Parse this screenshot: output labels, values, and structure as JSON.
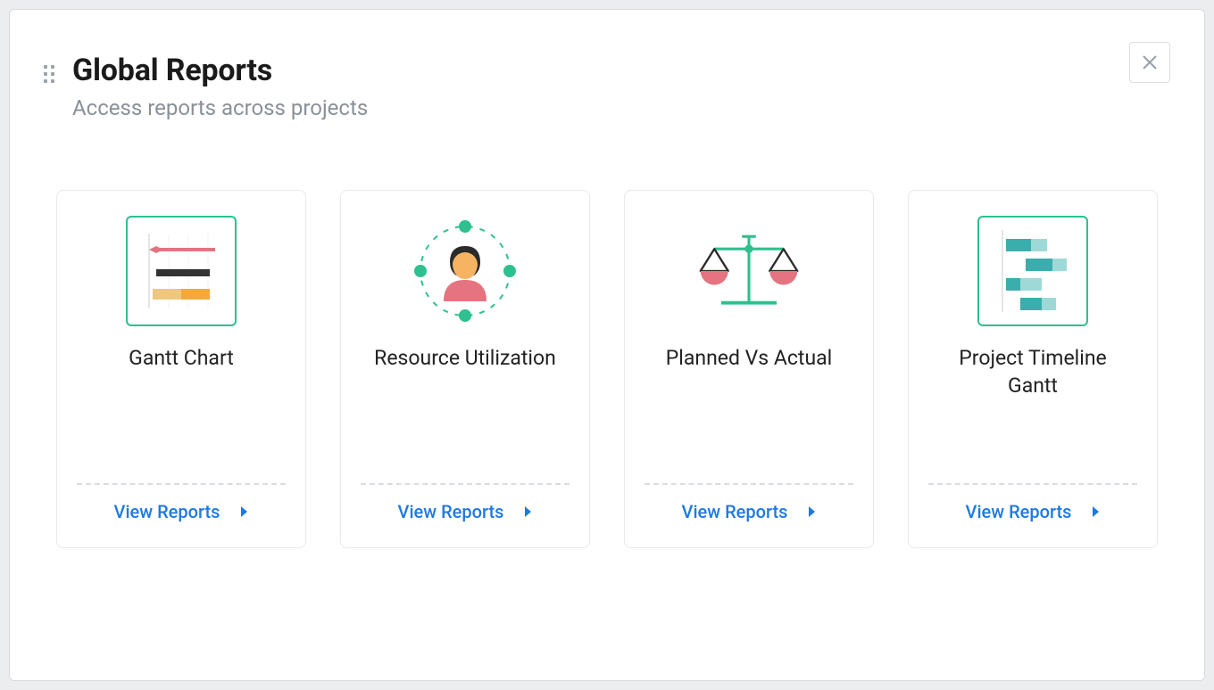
{
  "header": {
    "title": "Global Reports",
    "subtitle": "Access reports across projects"
  },
  "colors": {
    "link": "#1f7ae0",
    "accent_green": "#2ec08e",
    "accent_red": "#e57380",
    "accent_orange": "#f4a93a",
    "accent_teal": "#4bc1bf",
    "text_muted": "#8a9098"
  },
  "cards": [
    {
      "label": "Gantt Chart",
      "action": "View Reports",
      "icon": "gantt-chart-icon"
    },
    {
      "label": "Resource Utilization",
      "action": "View Reports",
      "icon": "resource-utilization-icon"
    },
    {
      "label": "Planned Vs Actual",
      "action": "View Reports",
      "icon": "balance-scale-icon"
    },
    {
      "label": "Project Timeline Gantt",
      "action": "View Reports",
      "icon": "timeline-gantt-icon"
    }
  ]
}
